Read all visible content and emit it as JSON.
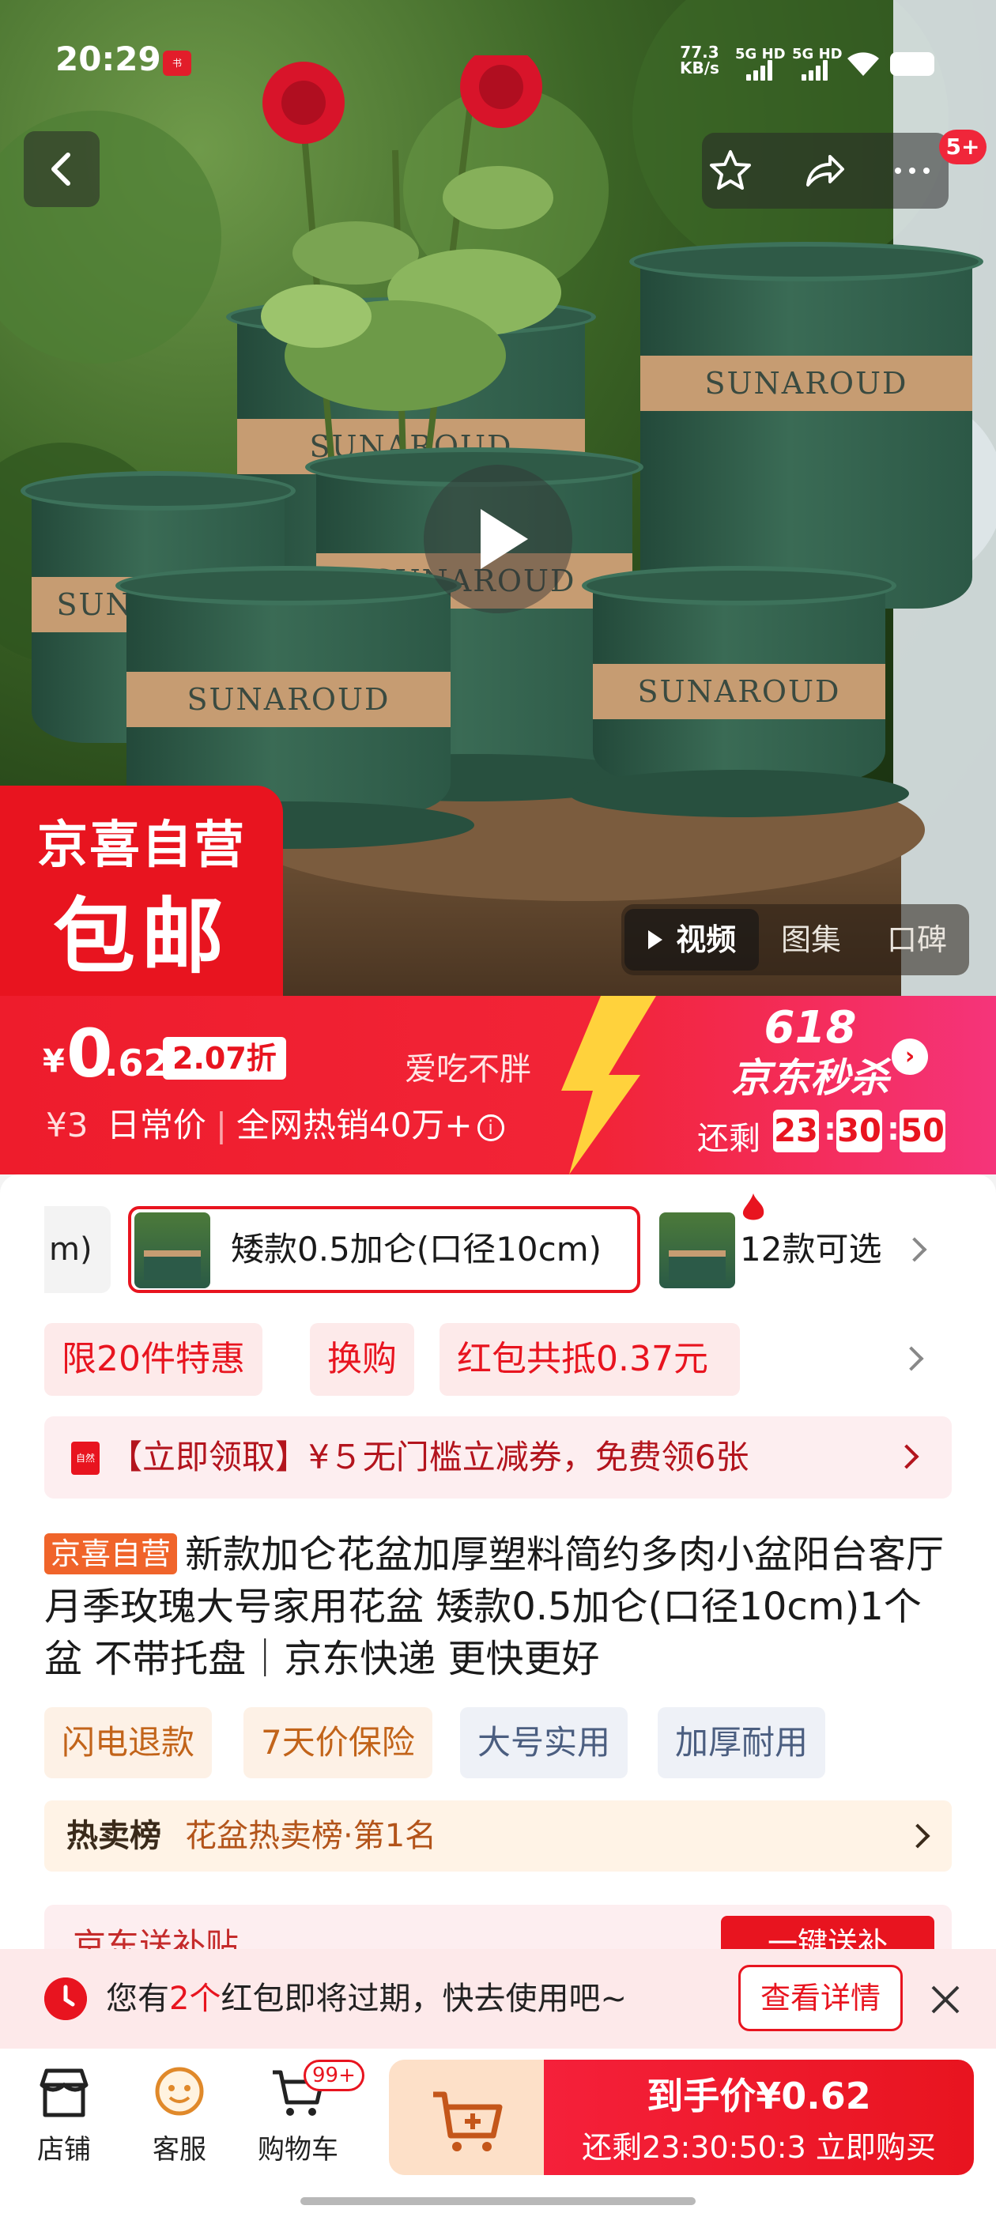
{
  "status_bar": {
    "time": "20:29",
    "net_speed_value": "77.3",
    "net_speed_unit": "KB/s",
    "sig1": "5G HD",
    "sig2": "5G HD"
  },
  "hero": {
    "cart_count_badge": "5+",
    "pot_brand": "SUNAROUD",
    "badge_line1": "京喜自营",
    "badge_line2": "包邮",
    "media_tabs": [
      "视频",
      "图集",
      "口碑"
    ]
  },
  "price_banner": {
    "currency": "¥",
    "price_int": "0",
    "price_dec": ".62",
    "discount": "2.07折",
    "nickname": "爱吃不胖",
    "daily_price": "¥3",
    "daily_label": "日常价",
    "sales": "全网热销40万+",
    "sale_number": "618",
    "sale_title": "京东秒杀",
    "countdown_label": "还剩",
    "countdown": [
      "23",
      "30",
      "50"
    ]
  },
  "variants": {
    "prev_partial": "m)",
    "selected": "矮款0.5加仑(口径10cm)",
    "count": "12款可选"
  },
  "promos": [
    "限20件特惠",
    "换购",
    "红包共抵0.37元"
  ],
  "coupon": {
    "icon_text": "自然",
    "text": "【立即领取】¥５无门槛立减券，免费领6张"
  },
  "product": {
    "tag": "京喜自营",
    "title": "新款加仑花盆加厚塑料简约多肉小盆阳台客厅月季玫瑰大号家用花盆 矮款0.5加仑(口径10cm)1个盆 不带托盘｜京东快递 更快更好"
  },
  "features": [
    "闪电退款",
    "7天价保险",
    "大号实用",
    "加厚耐用"
  ],
  "rank": {
    "label": "热卖榜",
    "value": "花盆热卖榜·第1名"
  },
  "peek": {
    "text": "京东送补贴",
    "button": "一键送补"
  },
  "notice": {
    "pre": "您有",
    "count": "2个",
    "post": "红包即将过期，快去使用吧~",
    "button": "查看详情"
  },
  "bottom_nav": {
    "shop": "店铺",
    "service": "客服",
    "cart": "购物车",
    "cart_badge": "99+",
    "buy_line1": "到手价¥0.62",
    "buy_line2": "还剩23:30:50:3  立即购买"
  },
  "colors": {
    "brand_red": "#e8141f",
    "pot_green": "#2c5846",
    "band_tan": "#c69c72"
  }
}
